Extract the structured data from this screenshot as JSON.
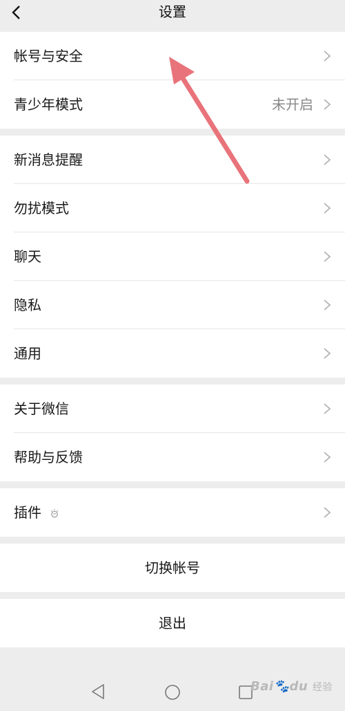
{
  "header": {
    "title": "设置"
  },
  "groups": [
    {
      "items": [
        {
          "label": "帐号与安全"
        },
        {
          "label": "青少年模式",
          "value": "未开启"
        }
      ]
    },
    {
      "items": [
        {
          "label": "新消息提醒"
        },
        {
          "label": "勿扰模式"
        },
        {
          "label": "聊天"
        },
        {
          "label": "隐私"
        },
        {
          "label": "通用"
        }
      ]
    },
    {
      "items": [
        {
          "label": "关于微信"
        },
        {
          "label": "帮助与反馈"
        }
      ]
    },
    {
      "items": [
        {
          "label": "插件",
          "icon": "plugin-bulb-icon"
        }
      ]
    }
  ],
  "actions": {
    "switch_account": "切换帐号",
    "logout": "退出"
  },
  "annotation": {
    "color": "#e8737a"
  },
  "watermark": {
    "brand": "Bai",
    "brand2": "du",
    "text": "经验"
  },
  "nav": {
    "icons": [
      "nav-back-icon",
      "nav-home-icon",
      "nav-recent-icon"
    ]
  }
}
